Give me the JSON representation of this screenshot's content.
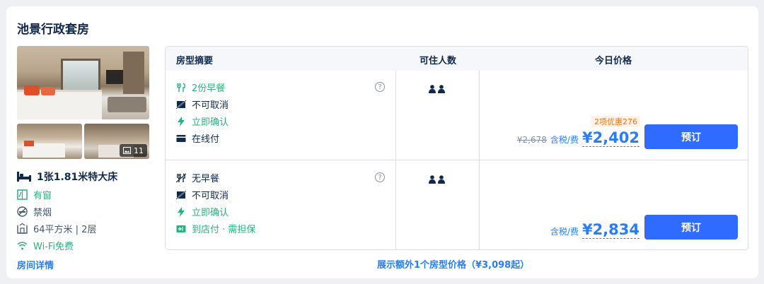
{
  "room": {
    "title": "池景行政套房",
    "photo_count": "11",
    "bed_type": "1张1.81米特大床",
    "features": [
      {
        "icon": "window-icon",
        "label": "有窗"
      },
      {
        "icon": "no-smoking-icon",
        "label": "禁烟"
      },
      {
        "icon": "area-icon",
        "label": "64平方米 | 2层"
      },
      {
        "icon": "wifi-icon",
        "label": "Wi-Fi免费"
      }
    ],
    "detail_link": "房间详情"
  },
  "table": {
    "headers": [
      "房型摘要",
      "可住人数",
      "今日价格"
    ],
    "rows": [
      {
        "options": [
          {
            "icon": "breakfast-icon",
            "label": "2份早餐",
            "green": true
          },
          {
            "icon": "no-cancel-icon",
            "label": "不可取消",
            "green": false
          },
          {
            "icon": "instant-confirm-icon",
            "label": "立即确认",
            "green": true
          },
          {
            "icon": "card-icon",
            "label": "在线付",
            "green": false
          }
        ],
        "help": "?",
        "discount": "2项优惠276",
        "original_price": "¥2,678",
        "tax_label": "含税/费",
        "price": "¥2,402",
        "book_label": "预订"
      },
      {
        "options": [
          {
            "icon": "no-breakfast-icon",
            "label": "无早餐",
            "green": false
          },
          {
            "icon": "no-cancel-icon",
            "label": "不可取消",
            "green": false
          },
          {
            "icon": "instant-confirm-icon",
            "label": "立即确认",
            "green": true
          },
          {
            "icon": "pay-at-hotel-icon",
            "label": "到店付 · 需担保",
            "green": true
          }
        ],
        "help": "?",
        "tax_label": "含税/费",
        "price": "¥2,834",
        "book_label": "预订"
      }
    ],
    "more_link": "展示额外1个房型价格（¥3,098起）"
  },
  "colors": {
    "accent": "#287dfa",
    "book_button": "#2f6bff",
    "green": "#24b47e",
    "discount": "#ff6f00"
  }
}
